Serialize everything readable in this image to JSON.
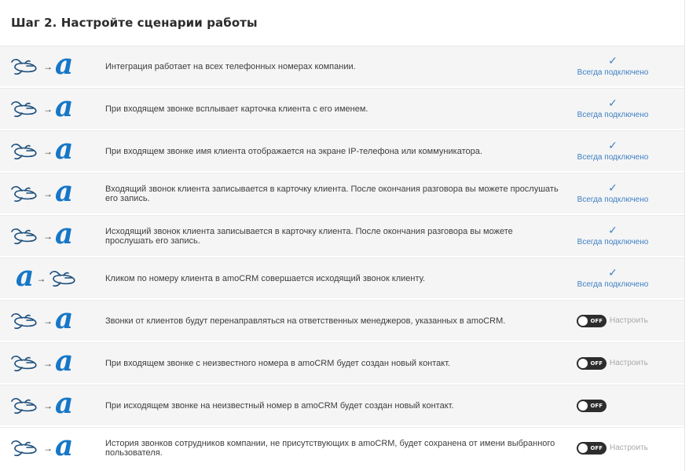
{
  "header": {
    "title": "Шаг  2.  Настройте сценарии работы"
  },
  "flow": {
    "arrow": "→",
    "amo_letter": "a",
    "telephony_icon": "phone-plane-icon"
  },
  "rows": [
    {
      "direction": "phone-to-amo",
      "description": "Интеграция работает на всех телефонных номерах компании.",
      "status_type": "always",
      "check": "✓",
      "status_label": "Всегда подключено"
    },
    {
      "direction": "phone-to-amo",
      "description": "При входящем звонке всплывает карточка клиента с его именем.",
      "status_type": "always",
      "check": "✓",
      "status_label": "Всегда подключено"
    },
    {
      "direction": "phone-to-amo",
      "description": "При входящем звонке имя клиента отображается на экране IP-телефона или коммуникатора.",
      "status_type": "always",
      "check": "✓",
      "status_label": "Всегда подключено"
    },
    {
      "direction": "phone-to-amo",
      "description": "Входящий звонок клиента записывается в карточку клиента. После окончания разговора вы можете прослушать его запись.",
      "status_type": "always",
      "check": "✓",
      "status_label": "Всегда подключено"
    },
    {
      "direction": "phone-to-amo",
      "description": "Исходящий звонок клиента записывается в карточку клиента. После окончания разговора вы можете прослушать его запись.",
      "status_type": "always",
      "check": "✓",
      "status_label": "Всегда подключено"
    },
    {
      "direction": "amo-to-phone",
      "description": "Кликом по номеру клиента в amoCRM совершается исходящий звонок клиенту.",
      "status_type": "always",
      "check": "✓",
      "status_label": "Всегда подключено"
    },
    {
      "direction": "phone-to-amo",
      "description": "Звонки от клиентов будут перенаправляться на ответственных менеджеров, указанных в amoCRM.",
      "status_type": "toggle",
      "toggle_text": "OFF",
      "configure_label": "Настроить"
    },
    {
      "direction": "phone-to-amo",
      "description": "При входящем звонке с неизвестного номера в amoCRM будет создан новый контакт.",
      "status_type": "toggle",
      "toggle_text": "OFF",
      "configure_label": "Настроить"
    },
    {
      "direction": "phone-to-amo",
      "description": "При исходящем звонке на неизвестный номер в amoCRM будет создан новый контакт.",
      "status_type": "toggle",
      "toggle_text": "OFF",
      "configure_label": ""
    },
    {
      "direction": "phone-to-amo",
      "description": "История звонков сотрудников компании, не присутствующих в amoCRM, будет сохранена от имени выбранного пользователя.",
      "status_type": "toggle",
      "toggle_text": "OFF",
      "configure_label": "Настроить"
    }
  ]
}
